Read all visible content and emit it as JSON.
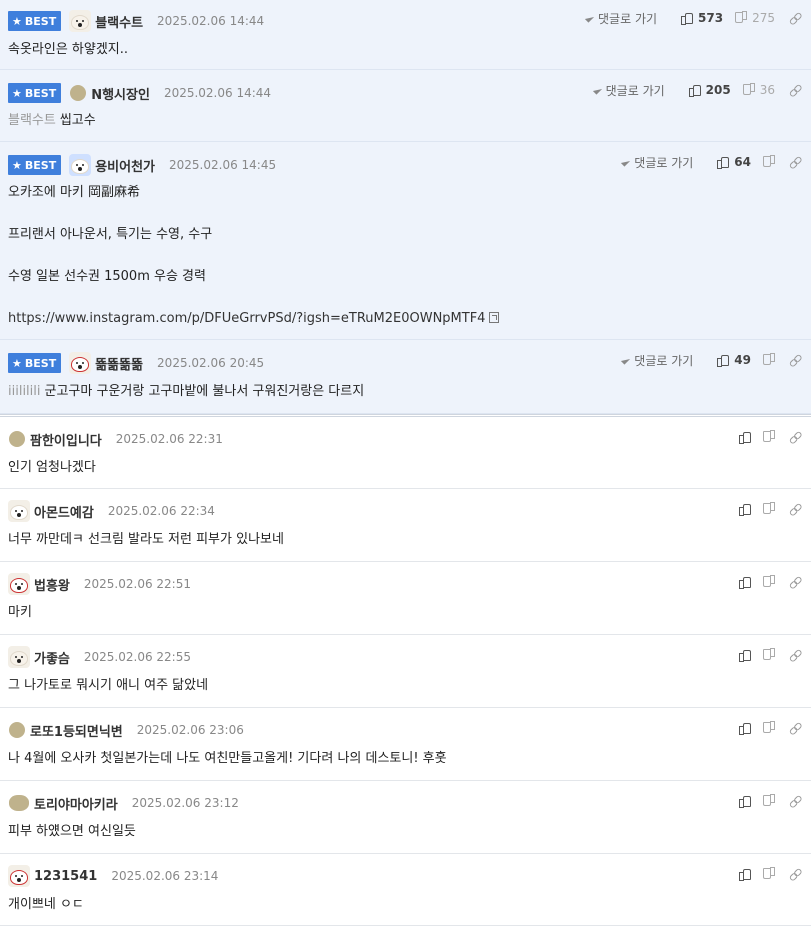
{
  "ui": {
    "best_label": "BEST",
    "goto_label": "댓글로 가기"
  },
  "best_comments": [
    {
      "nick": "블랙수트",
      "date": "2025.02.06 14:44",
      "text": "속옷라인은 하얗겠지..",
      "up": "573",
      "down": "275"
    },
    {
      "nick": "N행시장인",
      "date": "2025.02.06 14:44",
      "quote": "블랙수트",
      "text": "씹고수",
      "up": "205",
      "down": "36"
    },
    {
      "nick": "용비어천가",
      "date": "2025.02.06 14:45",
      "paras": [
        "오카조에 마키 岡副麻希",
        "프리랜서 아나운서, 특기는 수영, 수구",
        "수영 일본 선수권 1500m 우승 경력"
      ],
      "url": "https://www.instagram.com/p/DFUeGrrvPSd/?igsh=eTRuM2E0OWNpMTF4",
      "up": "64"
    },
    {
      "nick": "뚊뚊뚊뚊",
      "date": "2025.02.06 20:45",
      "quote": "iiililili",
      "text": "군고구마 구운거랑 고구마밭에 불나서 구워진거랑은 다르지",
      "up": "49"
    }
  ],
  "comments": [
    {
      "nick": "팜한이입니다",
      "date": "2025.02.06 22:31",
      "text": "인기 엄청나겠다"
    },
    {
      "nick": "아몬드예감",
      "date": "2025.02.06 22:34",
      "text": "너무 까만데ㅋ 선크림 발라도 저런 피부가 있나보네"
    },
    {
      "nick": "법흥왕",
      "date": "2025.02.06 22:51",
      "text": "마키"
    },
    {
      "nick": "가좋슴",
      "date": "2025.02.06 22:55",
      "text": "그 나가토로 뭐시기 애니 여주 닮았네"
    },
    {
      "nick": "로또1등되면닉변",
      "date": "2025.02.06 23:06",
      "text": "나 4월에 오사카 첫일본가는데 나도 여친만들고올게! 기다려 나의 데스토니! 후훗"
    },
    {
      "nick": "토리야마아키라",
      "date": "2025.02.06 23:12",
      "text": "피부 하얬으면 여신일듯"
    },
    {
      "nick": "1231541",
      "date": "2025.02.06 23:14",
      "text": "개이쁘네 ㅇㄷ"
    }
  ]
}
